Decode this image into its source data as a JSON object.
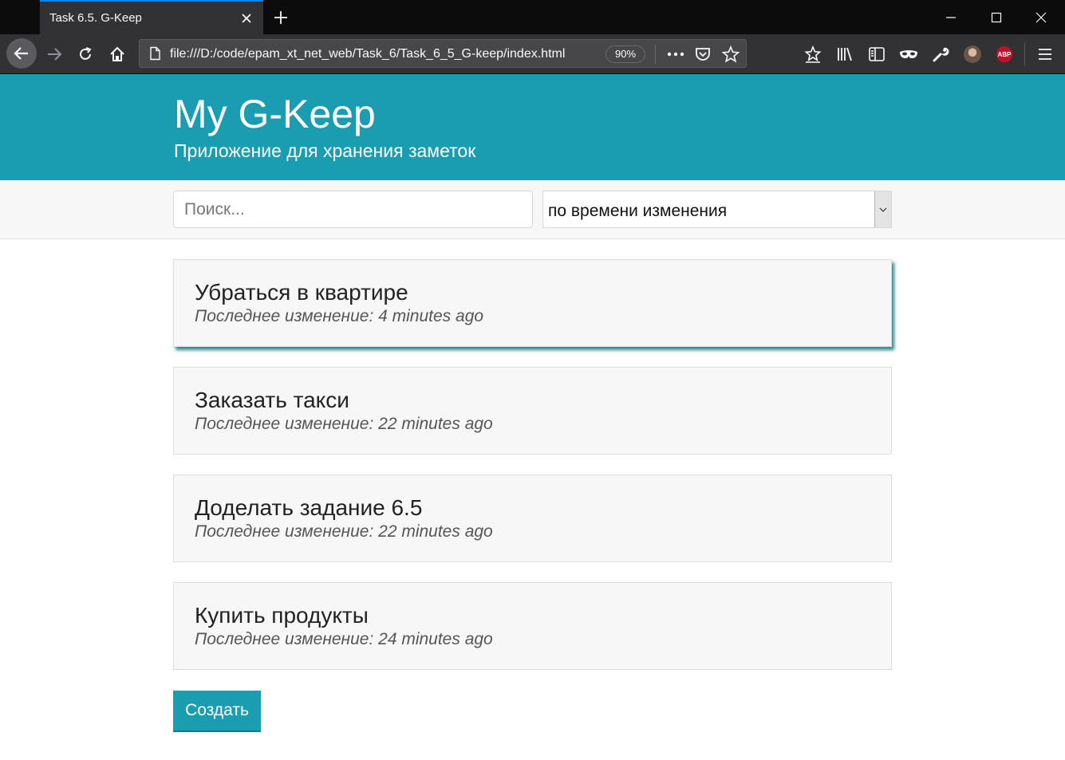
{
  "browser": {
    "tab_title": "Task 6.5. G-Keep",
    "url": "file:///D:/code/epam_xt_net_web/Task_6/Task_6_5_G-keep/index.html",
    "zoom": "90%",
    "abp_label": "ABP",
    "accent_color": "#0a84ff"
  },
  "app": {
    "title": "My G-Keep",
    "subtitle": "Приложение для хранения заметок",
    "brand_color": "#1a9db0"
  },
  "toolbar": {
    "search_placeholder": "Поиск...",
    "sort_selected": "по времени изменения"
  },
  "notes": [
    {
      "title": "Убраться в квартире",
      "meta": "Последнее изменение: 4 minutes ago"
    },
    {
      "title": "Заказать такси",
      "meta": "Последнее изменение: 22 minutes ago"
    },
    {
      "title": "Доделать задание 6.5",
      "meta": "Последнее изменение: 22 minutes ago"
    },
    {
      "title": "Купить продукты",
      "meta": "Последнее изменение: 24 minutes ago"
    }
  ],
  "create_label": "Создать"
}
